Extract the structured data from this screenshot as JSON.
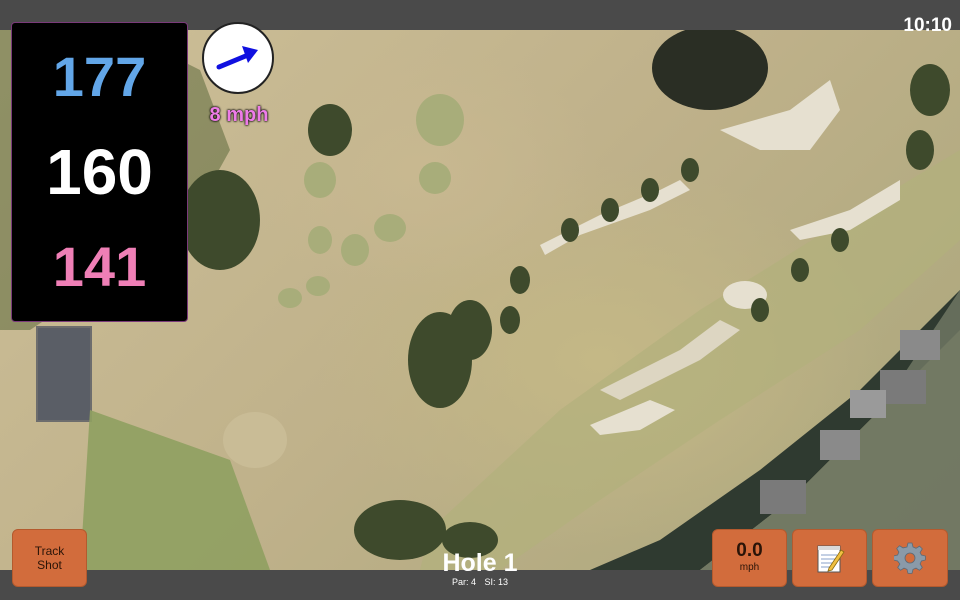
{
  "status": {
    "time": "10:10"
  },
  "distances": {
    "back": "177",
    "middle": "160",
    "front": "141"
  },
  "wind": {
    "speed_label": "8 mph",
    "direction_icon": "wind-arrow-icon"
  },
  "hole": {
    "title": "Hole 1",
    "par": "Par: 4",
    "stroke_index": "SI: 13"
  },
  "buttons": {
    "track_line1": "Track",
    "track_line2": "Shot",
    "speed_value": "0.0",
    "speed_unit": "mph",
    "notes_icon": "notepad-icon",
    "settings_icon": "gear-icon"
  },
  "colors": {
    "back_distance": "#62a6e8",
    "middle_distance": "#ffffff",
    "front_distance": "#ef7fb6",
    "wind_label": "#ee7ce8",
    "wind_arrow": "#1010e0",
    "button": "#d26c3c",
    "bar": "#4a4a4a"
  }
}
